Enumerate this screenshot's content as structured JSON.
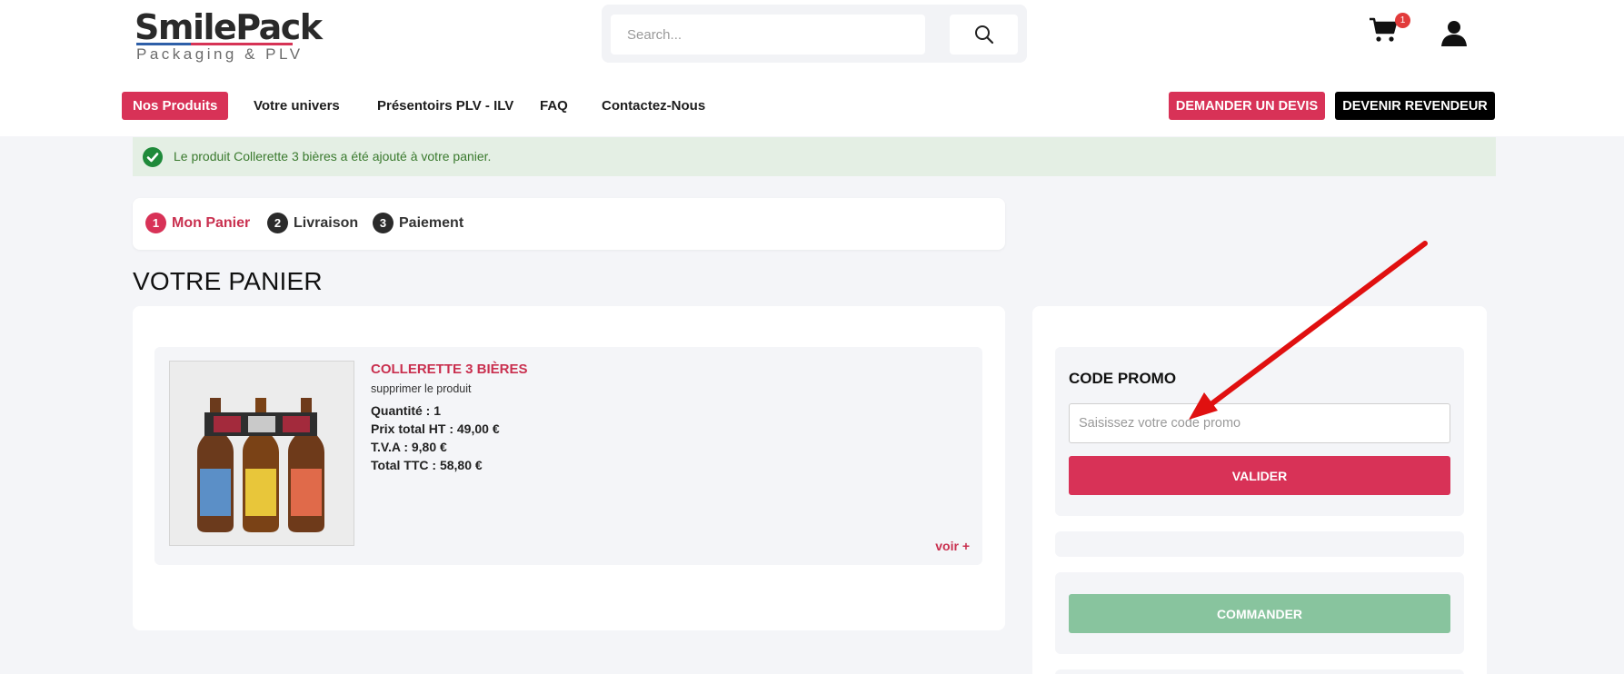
{
  "header": {
    "logo_main": "SmilePack",
    "logo_sub": "Packaging & PLV",
    "search_placeholder": "Search...",
    "cart_count": "1",
    "icons": {
      "search": "search-icon",
      "cart": "cart-icon",
      "user": "user-icon"
    }
  },
  "nav": {
    "items": [
      {
        "label": "Nos Produits",
        "active": true
      },
      {
        "label": "Votre univers"
      },
      {
        "label": "Présentoirs PLV - ILV"
      },
      {
        "label": "FAQ"
      },
      {
        "label": "Contactez-Nous"
      }
    ],
    "cta_devis": "DEMANDER UN DEVIS",
    "cta_revendeur": "DEVENIR REVENDEUR"
  },
  "notice": {
    "text": "Le produit Collerette 3 bières a été ajouté à votre panier.",
    "icon": "check-circle-icon"
  },
  "steps": [
    {
      "num": "1",
      "label": "Mon Panier",
      "active": true
    },
    {
      "num": "2",
      "label": "Livraison"
    },
    {
      "num": "3",
      "label": "Paiement"
    }
  ],
  "page_title": "VOTRE PANIER",
  "product": {
    "name": "COLLERETTE 3 BIÈRES",
    "remove_label": "supprimer le produit",
    "quantity": "Quantité : 1",
    "price_ht": "Prix total HT : 49,00 €",
    "tva": "T.V.A : 9,80 €",
    "total_ttc": "Total TTC : 58,80 €",
    "voir_label": "voir +"
  },
  "promo": {
    "title": "CODE PROMO",
    "placeholder": "Saisissez votre code promo",
    "valider_label": "VALIDER"
  },
  "order": {
    "commander_label": "COMMANDER"
  },
  "colors": {
    "brand_pink": "#d83257",
    "success_green": "#88c49e",
    "notice_bg": "#e4efe4",
    "annotation_arrow": "#e01010"
  }
}
